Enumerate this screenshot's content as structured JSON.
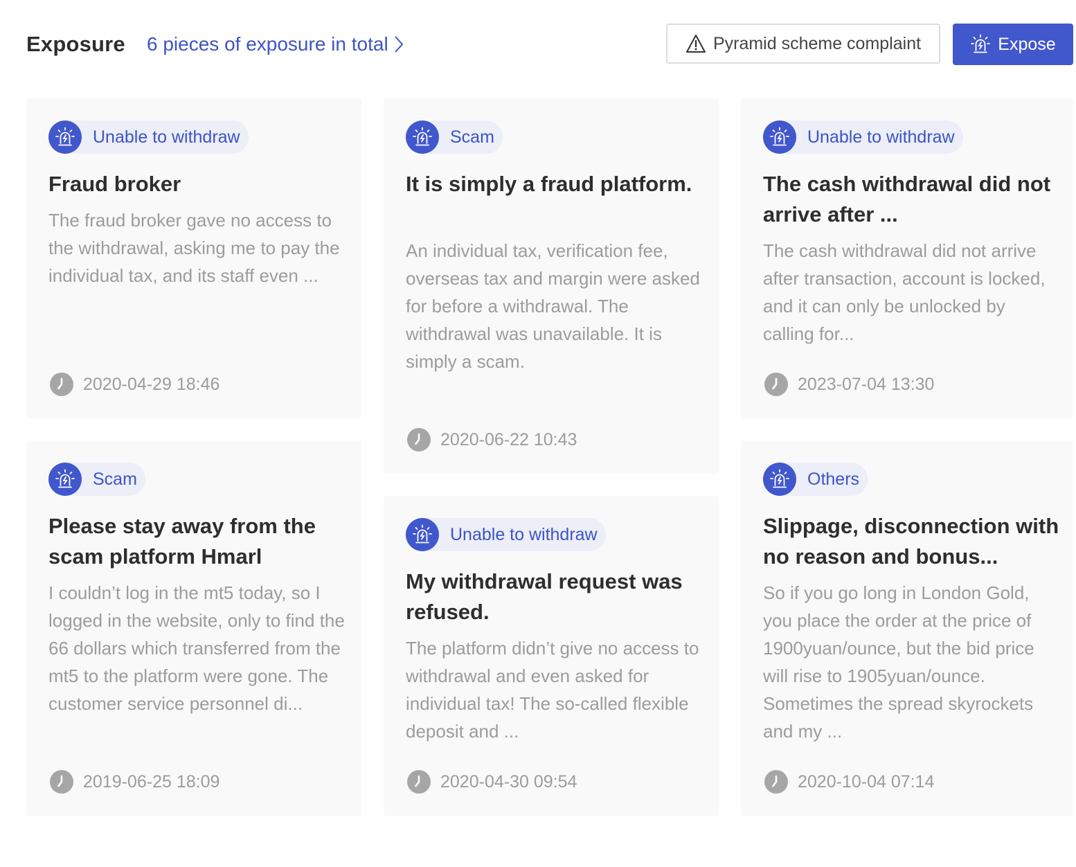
{
  "header": {
    "title": "Exposure",
    "total_link": "6 pieces of exposure in total",
    "complaint_button": "Pyramid scheme complaint",
    "expose_button": "Expose"
  },
  "colors": {
    "accent": "#4157cc",
    "link": "#3d54c4",
    "tag_bg": "#eceef8",
    "card_bg": "#f9f9f9",
    "muted_text": "#9c9c9c"
  },
  "cards": [
    {
      "tag": "Unable to withdraw",
      "title": "Fraud broker",
      "description": "The fraud broker gave no access to the withdrawal, asking me to pay the individual tax, and its staff even ...",
      "time": "2020-04-29 18:46"
    },
    {
      "tag": "Scam",
      "title": "It is simply a fraud platform.",
      "description": "An individual tax, verification fee, overseas tax and margin were asked for before a withdrawal. The withdrawal was unavailable. It is simply a scam.",
      "time": "2020-06-22 10:43"
    },
    {
      "tag": "Unable to withdraw",
      "title": "The cash withdrawal did not arrive after ...",
      "description": "The cash withdrawal did not arrive after transaction, account is locked, and it can only be unlocked by calling for...",
      "time": "2023-07-04 13:30"
    },
    {
      "tag": "Scam",
      "title": "Please stay away from the scam platform Hmarl",
      "description": "I couldn’t log in the mt5 today, so I logged in the website, only to find the 66 dollars which transferred from the mt5 to the platform were gone. The customer service personnel di...",
      "time": "2019-06-25 18:09"
    },
    {
      "tag": "Unable to withdraw",
      "title": "My withdrawal request was refused.",
      "description": "The platform didn’t give no access to withdrawal and even asked for individual tax! The so-called flexible deposit and ...",
      "time": "2020-04-30 09:54"
    },
    {
      "tag": "Others",
      "title": "Slippage, disconnection with no reason and bonus...",
      "description": "So if you go long in London Gold, you place the order at the price of 1900yuan/ounce, but the bid price will rise to 1905yuan/ounce. Sometimes the spread skyrockets and my ...",
      "time": "2020-10-04 07:14"
    }
  ],
  "icons": {
    "tag_icon": "alarm-siren-icon",
    "time_icon": "clock-icon",
    "link_icon": "chevron-right-icon",
    "complaint_icon": "warning-triangle-icon"
  }
}
